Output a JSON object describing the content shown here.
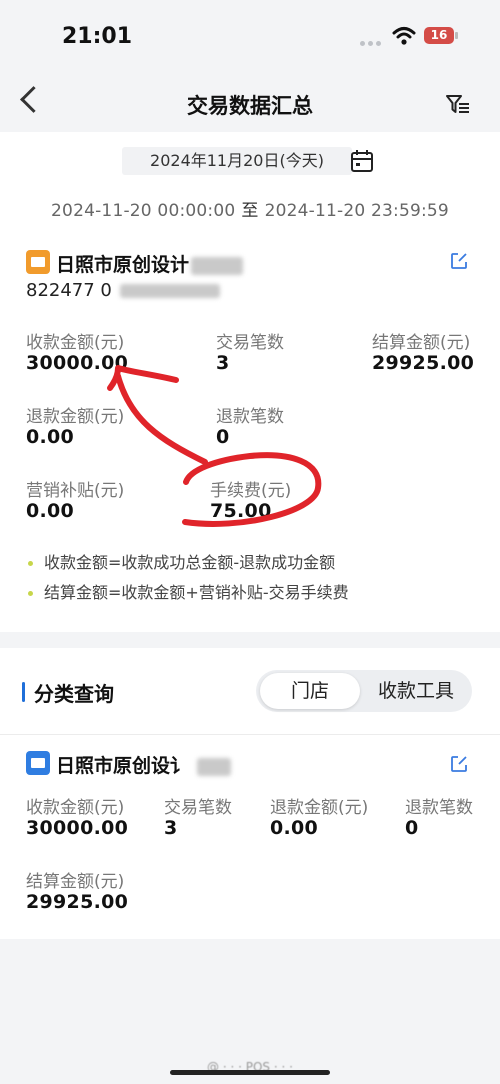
{
  "status_bar": {
    "time": "21:01",
    "battery": "16"
  },
  "header": {
    "title": "交易数据汇总"
  },
  "date": {
    "selected": "2024年11月20日(今天)",
    "range_start": "2024-11-20 00:00:00",
    "range_sep": "至",
    "range_end": "2024-11-20 23:59:59"
  },
  "summary": {
    "store_name": "日照市原创设计",
    "merchant_no": "822477 0",
    "metrics": {
      "collect_label": "收款金额(元)",
      "collect_value": "30000.00",
      "count_label": "交易笔数",
      "count_value": "3",
      "settle_label": "结算金额(元)",
      "settle_value": "29925.00",
      "refund_label": "退款金额(元)",
      "refund_value": "0.00",
      "refund_count_label": "退款笔数",
      "refund_count_value": "0",
      "subsidy_label": "营销补贴(元)",
      "subsidy_value": "0.00",
      "fee_label": "手续费(元)",
      "fee_value": "75.00"
    },
    "notes": [
      "收款金额=收款成功总金额-退款成功金额",
      "结算金额=收款金额+营销补贴-交易手续费"
    ]
  },
  "category": {
    "title": "分类查询",
    "tabs": [
      {
        "label": "门店",
        "active": true
      },
      {
        "label": "收款工具",
        "active": false
      }
    ]
  },
  "store_detail": {
    "store_name": "日照市原创设讠",
    "collect_label": "收款金额(元)",
    "collect_value": "30000.00",
    "count_label": "交易笔数",
    "count_value": "3",
    "refund_label": "退款金额(元)",
    "refund_value": "0.00",
    "refund_count_label": "退款笔数",
    "refund_count_value": "0",
    "settle_label": "结算金额(元)",
    "settle_value": "29925.00"
  },
  "colors": {
    "accent_blue": "#1f6fd9",
    "store_icon_orange": "#f19b2c",
    "annotation_red": "#e0242a"
  }
}
